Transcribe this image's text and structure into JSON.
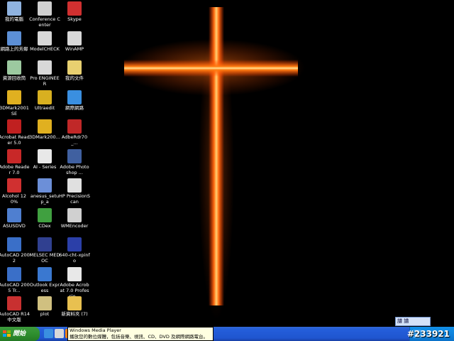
{
  "desktop_icons": [
    {
      "label": "我的電腦",
      "icon": "computer-icon",
      "color": "#8fb3e0"
    },
    {
      "label": "網路上的芳鄰",
      "icon": "network-icon",
      "color": "#5c8fd6"
    },
    {
      "label": "資源回收筒",
      "icon": "recycle-bin-icon",
      "color": "#9cc9a0"
    },
    {
      "label": "3DMark2001 SE",
      "icon": "3dmark-icon",
      "color": "#e0b020"
    },
    {
      "label": "Acrobat Reader 5.0",
      "icon": "acrobat-icon",
      "color": "#c02020"
    },
    {
      "label": "Adobe Reader 7.0",
      "icon": "adobe-reader-icon",
      "color": "#c82828"
    },
    {
      "label": "Alcohol 120%",
      "icon": "alcohol-icon",
      "color": "#d03030"
    },
    {
      "label": "ASUSDVD",
      "icon": "dvd-icon",
      "color": "#4f7fd0"
    },
    {
      "label": "AutoCAD 2002",
      "icon": "autocad-icon",
      "color": "#3a6fc8"
    },
    {
      "label": "AutoCAD 2005 Tr...",
      "icon": "autocad-icon",
      "color": "#3a6fc8"
    },
    {
      "label": "AutoCAD R14 中文版",
      "icon": "autocad-icon",
      "color": "#c83030"
    },
    {
      "label": "Conference Center",
      "icon": "conference-icon",
      "color": "#d0d0d0"
    },
    {
      "label": "ModelCHECK",
      "icon": "modelcheck-icon",
      "color": "#d8d8d8"
    },
    {
      "label": "Pro ENGINEER",
      "icon": "proe-icon",
      "color": "#d8d8d8"
    },
    {
      "label": "Ultraedit",
      "icon": "ultraedit-icon",
      "color": "#d8b020"
    },
    {
      "label": "3DMark200...",
      "icon": "3dmark-icon",
      "color": "#e0b020"
    },
    {
      "label": "AI - Series",
      "icon": "document-icon",
      "color": "#e8e8e8"
    },
    {
      "label": "anesus_setup_a",
      "icon": "setup-icon",
      "color": "#6c8fd8"
    },
    {
      "label": "CDex",
      "icon": "cdex-icon",
      "color": "#40a040"
    },
    {
      "label": "MELSEC MEDOC",
      "icon": "melsec-icon",
      "color": "#304090"
    },
    {
      "label": "Outlook Express",
      "icon": "outlook-icon",
      "color": "#3a78d0"
    },
    {
      "label": "plot",
      "icon": "plot-icon",
      "color": "#d0c080"
    },
    {
      "label": "Skype",
      "icon": "skype-icon",
      "color": "#d03030"
    },
    {
      "label": "WinAMP",
      "icon": "winamp-icon",
      "color": "#d8d8d8"
    },
    {
      "label": "我的文件",
      "icon": "my-documents-icon",
      "color": "#e8d070"
    },
    {
      "label": "網際網路",
      "icon": "internet-explorer-icon",
      "color": "#3a8fe0"
    },
    {
      "label": "AdbeRdr70_...",
      "icon": "adobe-setup-icon",
      "color": "#c02828"
    },
    {
      "label": "Adobe Photoshop ...",
      "icon": "photoshop-icon",
      "color": "#4060a0"
    },
    {
      "label": "HP PrecisionScan",
      "icon": "scanner-icon",
      "color": "#e0e0e0"
    },
    {
      "label": "WMEncoder",
      "icon": "wmencoder-icon",
      "color": "#d0d0d0"
    },
    {
      "label": "640-cht-xpinfo",
      "icon": "hp-icon",
      "color": "#2b3fa8"
    },
    {
      "label": "Adobe Acrobat 7.0 Professio...",
      "icon": "acrobat-pro-icon",
      "color": "#e8e8e8"
    },
    {
      "label": "新資料夾 (7)",
      "icon": "folder-icon",
      "color": "#e8c050"
    }
  ],
  "taskbar": {
    "start_label": "開始",
    "clock": "#233921"
  },
  "langbar": {
    "text": "譜 譜"
  },
  "tooltip": {
    "title": "Windows Media Player",
    "text": "播放您的數位媒體，包括音樂、視訊、CD、DVD 及網際網路電台。"
  },
  "colors": {
    "taskbar": "#245edb",
    "start": "#2f8f2f",
    "tray": "#0f83dd"
  }
}
